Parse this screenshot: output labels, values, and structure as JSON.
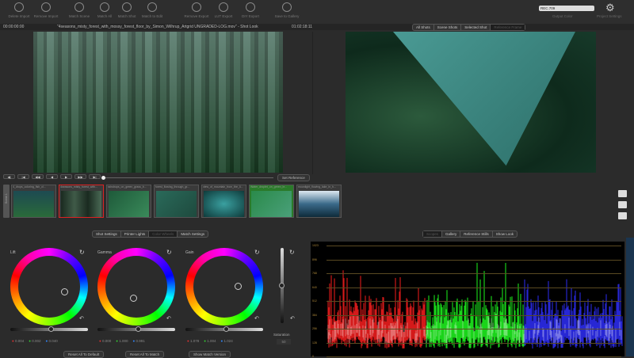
{
  "toolbar": {
    "tools": [
      {
        "label": "Delete Import",
        "icon": "database-icon"
      },
      {
        "label": "Remove Import",
        "icon": "import-icon"
      },
      {
        "label": "Match Scene",
        "icon": "match-scene-icon"
      },
      {
        "label": "Match All",
        "icon": "match-all-icon"
      },
      {
        "label": "Match Shot",
        "icon": "match-shot-icon"
      },
      {
        "label": "Match to Edit",
        "icon": "match-edit-icon"
      },
      {
        "label": "Remove Export",
        "icon": "remove-export-icon"
      },
      {
        "label": "LUT Export",
        "icon": "lut-export-icon"
      },
      {
        "label": "DIY Export",
        "icon": "diy-export-icon"
      },
      {
        "label": "Save to Gallery",
        "icon": "gallery-icon"
      }
    ],
    "output_color_value": "REC.709",
    "output_color_label": "Output Color",
    "project_settings_label": "Project Settings"
  },
  "clipbar": {
    "timecode_start": "00:00:00:00",
    "filename": "\"4seasons_misty_forest_with_mossy_forest_floor_by_Simon_Wilhrup_Artgrid UNGRADED-LOG.mov\" - Shot Look",
    "timecode_end": "01:02:18:11"
  },
  "view_tabs": [
    "All Shots",
    "Scene Shots",
    "Selected Shot",
    "Reference Frame"
  ],
  "transport": {
    "buttons": [
      "◀|",
      "|◀",
      "◀◀",
      "◀",
      "▶",
      "▶▶",
      "▶|"
    ],
    "set_reference": "Set Reference"
  },
  "thumbnails": [
    {
      "title": "4_drops_coloring_fish_cl..."
    },
    {
      "title": "4seasons_misty_forest_with..."
    },
    {
      "title": "raindrops_on_green_grass_b..."
    },
    {
      "title": "forest_flowing_through_gr..."
    },
    {
      "title": "view_of_mountain_from_the_li..."
    },
    {
      "title": "Water_droplet_on_green_le..."
    },
    {
      "title": "moonlight_flowing_lake_in_h..."
    }
  ],
  "thumb_strip_label": "Scene 1",
  "grade_tabs": [
    "Shot Settings",
    "Printer Lights",
    "Color Wheels",
    "Match Settings"
  ],
  "wheels": [
    {
      "label": "Lift",
      "r": "0.004",
      "g": "0.002",
      "b": "0.040"
    },
    {
      "label": "Gamma",
      "r": "0.000",
      "g": "1.000",
      "b": "0.991"
    },
    {
      "label": "Gain",
      "r": "1.078",
      "g": "1.004",
      "b": "1.024"
    }
  ],
  "saturation": {
    "label": "Saturation",
    "value": "50"
  },
  "bottom_buttons": [
    "Reset All To Default",
    "Reset All To Match",
    "Show Match Version"
  ],
  "scope_tabs": [
    "Scopes",
    "Gallery",
    "Reference Stills",
    "Show Look"
  ],
  "scope": {
    "ticks": [
      "1023",
      "896",
      "768",
      "640",
      "512",
      "384",
      "256",
      "128",
      "0"
    ],
    "colors": {
      "red": "#ff2020",
      "green": "#20ff20",
      "blue": "#3030ff"
    }
  }
}
